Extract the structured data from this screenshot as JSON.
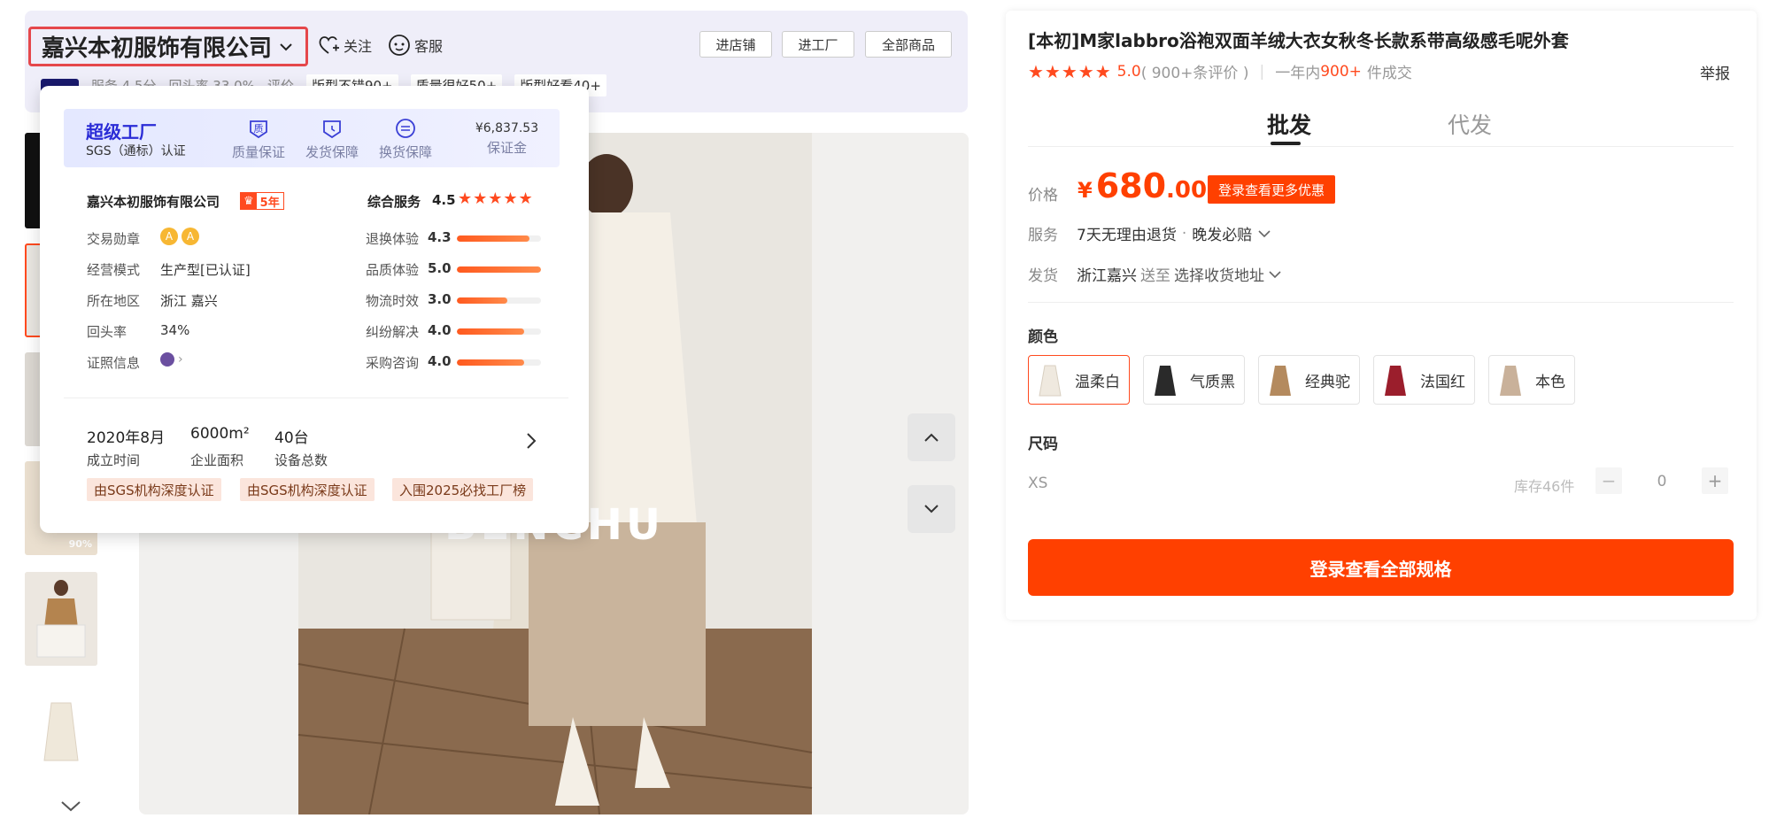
{
  "header": {
    "shop_name": "嘉兴本初服饰有限公司",
    "follow_label": "关注",
    "service_label": "客服",
    "btn_enter_shop": "进店铺",
    "btn_enter_factory": "进工厂",
    "btn_all_products": "全部商品",
    "sub_service": "服务 4.5分",
    "sub_return": "回头率 33.0%",
    "sub_review": "评价",
    "sub_tags": [
      "版型不错90+",
      "质量很好50+",
      "版型好看40+"
    ]
  },
  "popup": {
    "super_factory": "超级工厂",
    "sgs": "SGS（通标）认证",
    "guarantees": [
      {
        "icon": "quality-icon",
        "label": "质量保证"
      },
      {
        "icon": "shipping-icon",
        "label": "发货保障"
      },
      {
        "icon": "exchange-icon",
        "label": "换货保障"
      }
    ],
    "deposit_amount": "¥6,837.53",
    "deposit_label": "保证金",
    "company_name": "嘉兴本初服饰有限公司",
    "years_badge": "5年",
    "info_rows": [
      {
        "label": "交易勋章",
        "value": ""
      },
      {
        "label": "经营模式",
        "value": "生产型[已认证]"
      },
      {
        "label": "所在地区",
        "value": "浙江 嘉兴"
      },
      {
        "label": "回头率",
        "value": "34%"
      },
      {
        "label": "证照信息",
        "value": ""
      }
    ],
    "overall_label": "综合服务",
    "overall_score": "4.5",
    "scores": [
      {
        "label": "退换体验",
        "score": "4.3",
        "fill": 0.86
      },
      {
        "label": "品质体验",
        "score": "5.0",
        "fill": 1.0
      },
      {
        "label": "物流时效",
        "score": "3.0",
        "fill": 0.6
      },
      {
        "label": "纠纷解决",
        "score": "4.0",
        "fill": 0.8
      },
      {
        "label": "采购咨询",
        "score": "4.0",
        "fill": 0.8
      }
    ],
    "stats": [
      {
        "value": "2020年8月",
        "label": "成立时间"
      },
      {
        "value": "6000m²",
        "label": "企业面积"
      },
      {
        "value": "40台",
        "label": "设备总数"
      }
    ],
    "badges": [
      "由SGS机构深度认证",
      "由SGS机构深度认证",
      "入围2025必找工厂榜"
    ]
  },
  "gallery": {
    "watermark": "BENCHU",
    "thumb_badge": "90%"
  },
  "product": {
    "title": "[本初]M家labbro浴袍双面羊绒大衣女秋冬长款系带高级感毛呢外套",
    "rating": "5.0",
    "reviews": "( 900+条评价 )",
    "sold_prefix": "一年内",
    "sold_num": "900+",
    "sold_suffix": "件成交",
    "report": "举报",
    "tab_wholesale": "批发",
    "tab_dropship": "代发",
    "price_label": "价格",
    "price_symbol": "¥",
    "price_int": "680",
    "price_dec": ".00",
    "promo": "登录查看更多优惠",
    "service_label": "服务",
    "service_value": "7天无理由退货",
    "service_extra": "晚发必赔",
    "ship_label": "发货",
    "ship_from": "浙江嘉兴",
    "ship_to": "送至",
    "ship_select": "选择收货地址",
    "color_label": "颜色",
    "colors": [
      {
        "name": "温柔白",
        "swatch": "#efe9df"
      },
      {
        "name": "气质黑",
        "swatch": "#2a2a2a"
      },
      {
        "name": "经典驼",
        "swatch": "#b48a5e"
      },
      {
        "name": "法国红",
        "swatch": "#9b1e2c"
      },
      {
        "name": "本色",
        "swatch": "#c9b19a"
      }
    ],
    "size_label": "尺码",
    "size": "XS",
    "stock": "库存46件",
    "qty": "0",
    "buy_label": "登录查看全部规格"
  },
  "colors": {
    "accent": "#ff4000",
    "price": "#ff4000",
    "super": "#2a2bd6"
  }
}
